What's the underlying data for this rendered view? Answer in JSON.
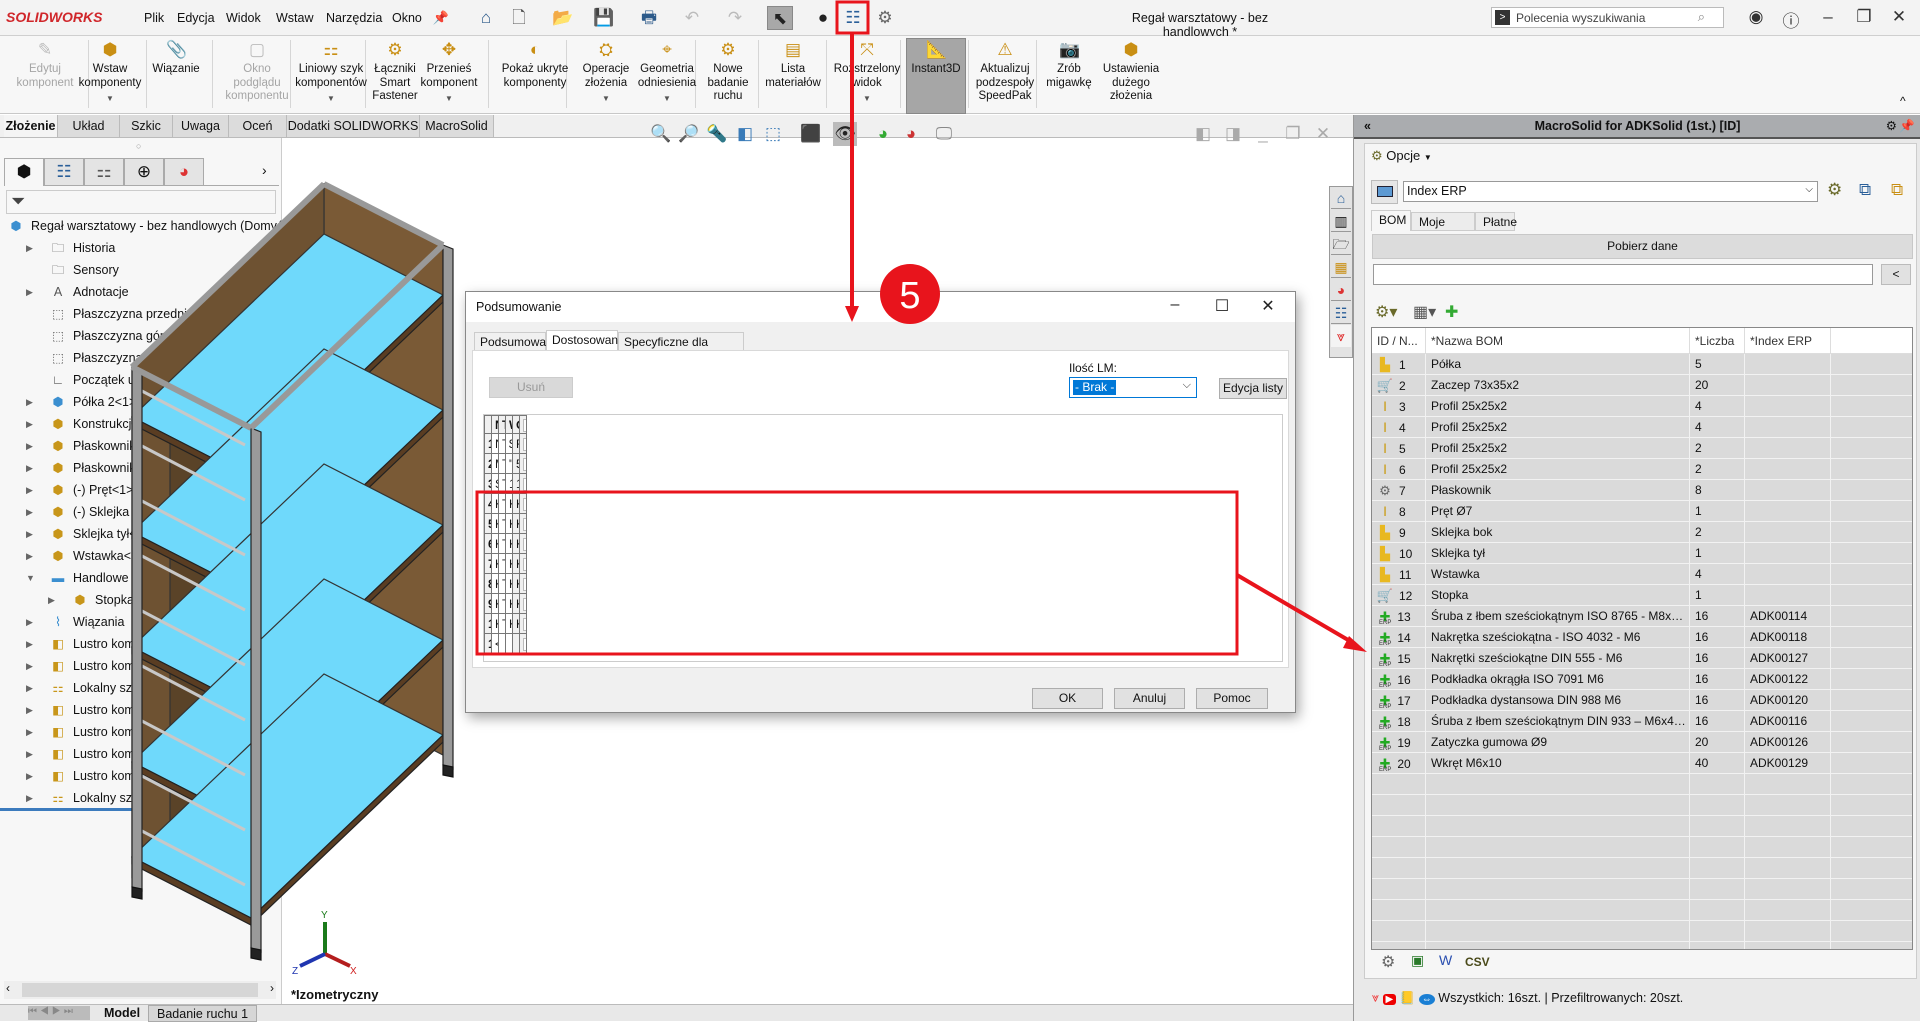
{
  "titlebar": {
    "app": "SOLIDWORKS",
    "menu": [
      "Plik",
      "Edycja",
      "Widok",
      "Wstaw",
      "Narzędzia",
      "Okno"
    ],
    "document_title": "Regał warsztatowy - bez handlowych *",
    "search_placeholder": "Polecenia wyszukiwania"
  },
  "ribbon": [
    {
      "label": "Edytuj\nkomponent",
      "icon": "edit-component-icon",
      "disabled": true
    },
    {
      "label": "Wstaw\nkomponenty",
      "icon": "insert-components-icon",
      "dropdown": true
    },
    {
      "label": "Wiązanie",
      "icon": "mate-paperclip-icon"
    },
    {
      "label": "Okno\npodglądu\nkomponentu",
      "icon": "component-preview-icon",
      "disabled": true
    },
    {
      "label": "Liniowy szyk\nkomponentów",
      "icon": "linear-pattern-icon",
      "dropdown": true
    },
    {
      "label": "Łączniki\nSmart\nFastener",
      "icon": "smart-fastener-icon"
    },
    {
      "label": "Przenieś\nkomponent",
      "icon": "move-component-icon",
      "dropdown": true
    },
    {
      "label": "Pokaż ukryte\nkomponenty",
      "icon": "show-hidden-icon"
    },
    {
      "label": "Operacje\nzłożenia",
      "icon": "assembly-features-icon",
      "dropdown": true
    },
    {
      "label": "Geometria\nodniesienia",
      "icon": "reference-geometry-icon",
      "dropdown": true
    },
    {
      "label": "Nowe\nbadanie\nruchu",
      "icon": "motion-study-icon"
    },
    {
      "label": "Lista\nmateriałów",
      "icon": "bill-of-materials-icon"
    },
    {
      "label": "Rozstrzelony\nwidok",
      "icon": "exploded-view-icon",
      "dropdown": true
    },
    {
      "label": "Instant3D",
      "icon": "instant3d-icon",
      "active": true
    },
    {
      "label": "Aktualizuj\npodzespoły\nSpeedPak",
      "icon": "speedpak-icon"
    },
    {
      "label": "Zrób\nmigawkę",
      "icon": "camera-icon"
    },
    {
      "label": "Ustawienia\ndużego\nzłożenia",
      "icon": "large-assembly-icon"
    }
  ],
  "cm_tabs": [
    "Złożenie",
    "Układ",
    "Szkic",
    "Uwaga",
    "Oceń",
    "Dodatki SOLIDWORKS",
    "MacroSolid"
  ],
  "tree": {
    "root": "Regał warsztatowy - bez handlowych  (Domyśln",
    "items": [
      {
        "label": "Historia",
        "icon": "history-folder-icon",
        "arrow": true,
        "indent": 0
      },
      {
        "label": "Sensory",
        "icon": "sensors-folder-icon",
        "arrow": false,
        "indent": 0
      },
      {
        "label": "Adnotacje",
        "icon": "annotations-folder-icon",
        "arrow": true,
        "indent": 0
      },
      {
        "label": "Płaszczyzna przednia",
        "icon": "plane-icon",
        "arrow": false,
        "indent": 0
      },
      {
        "label": "Płaszczyzna górna",
        "icon": "plane-icon",
        "arrow": false,
        "indent": 0
      },
      {
        "label": "Płaszczyzna prawa",
        "icon": "plane-icon",
        "arrow": false,
        "indent": 0
      },
      {
        "label": "Początek układu",
        "icon": "origin-icon",
        "arrow": false,
        "indent": 0
      },
      {
        "label": "Półka 2<1>",
        "icon": "subassembly-icon",
        "arrow": true,
        "indent": 0
      },
      {
        "label": "Konstrukcja<1>",
        "icon": "part-icon",
        "arrow": true,
        "indent": 0
      },
      {
        "label": "Płaskownik<1>",
        "icon": "part-icon",
        "arrow": true,
        "indent": 0
      },
      {
        "label": "Płaskownik<2>",
        "icon": "part-icon",
        "arrow": true,
        "indent": 0
      },
      {
        "label": "(-) Pręt<1>",
        "icon": "part-icon",
        "arrow": true,
        "indent": 0
      },
      {
        "label": "(-) Sklejka bok<1>",
        "icon": "part-icon",
        "arrow": true,
        "indent": 0
      },
      {
        "label": "Sklejka tył<1>",
        "icon": "part-icon",
        "arrow": true,
        "indent": 0
      },
      {
        "label": "Wstawka<1>",
        "icon": "part-icon",
        "arrow": true,
        "indent": 0
      },
      {
        "label": "Handlowe",
        "icon": "folder-icon",
        "arrow": true,
        "expanded": true,
        "indent": 0
      },
      {
        "label": "Stopka<1>",
        "icon": "part-icon",
        "arrow": true,
        "indent": 1
      },
      {
        "label": "Wiązania",
        "icon": "mates-icon",
        "arrow": true,
        "indent": 0
      },
      {
        "label": "Lustro komponentów",
        "icon": "mirror-components-icon",
        "arrow": true,
        "indent": 0
      },
      {
        "label": "Lustro komponentów",
        "icon": "mirror-components-icon",
        "arrow": true,
        "indent": 0
      },
      {
        "label": "Lokalny szyk liniowy",
        "icon": "local-pattern-icon",
        "arrow": true,
        "indent": 0
      },
      {
        "label": "Lustro komponentów",
        "icon": "mirror-components-icon",
        "arrow": true,
        "indent": 0
      },
      {
        "label": "Lustro komponentów",
        "icon": "mirror-components-icon",
        "arrow": true,
        "indent": 0
      },
      {
        "label": "Lustro komponentów",
        "icon": "mirror-components-icon",
        "arrow": true,
        "indent": 0
      },
      {
        "label": "Lustro komponentów",
        "icon": "mirror-components-icon",
        "arrow": true,
        "indent": 0
      },
      {
        "label": "Lokalny szyk liniowy",
        "icon": "local-pattern-icon",
        "arrow": true,
        "indent": 0
      }
    ]
  },
  "viewport": {
    "view_label": "*Izometryczny",
    "triad": {
      "x": "X",
      "y": "Y",
      "z": "Z"
    }
  },
  "bottom_tabs": [
    "Model",
    "Badanie ruchu 1"
  ],
  "dialog": {
    "title": "Podsumowanie",
    "tabs": [
      "Podsumowanie",
      "Dostosowany",
      "Specyficzne dla konfiguracji"
    ],
    "active_tab": "Dostosowany",
    "delete_label": "Usuń",
    "bom_qty_label": "Ilość LM:",
    "bom_qty_value": "- Brak -",
    "edit_list_label": "Edycja listy",
    "columns": [
      "Nazwa właściwości",
      "Typ",
      "Wartość / Wyrażenie tekstowe",
      "Oszacowana wartość"
    ],
    "rows": [
      {
        "n": "1",
        "name": "Nazwa",
        "type": "Tekst",
        "value": "$PRP:\"SW-Nazwa pliku\"",
        "evaluated": "Regał warsztatowy - bez ha"
      },
      {
        "n": "2",
        "name": "Masa",
        "type": "Tekst",
        "value": "\"SW-Masa@Regał warsztatowy - bez handlowych.SL",
        "evaluated": "56227.33"
      },
      {
        "n": "3",
        "name": "Szt.",
        "type": "Tekst",
        "value": "1",
        "evaluated": "1"
      },
      {
        "n": "4",
        "name": "KOMPONENT-0",
        "type": "Tekst",
        "value": "KOMPONENT;ADK00114;Śruba z łbem sześciokątnym",
        "evaluated": "KOMPONENT;ADK00114;Śr"
      },
      {
        "n": "5",
        "name": "KOMPONENT-1",
        "type": "Tekst",
        "value": "KOMPONENT;ADK00118;Nakrętka sześciokątna - ISO",
        "evaluated": "KOMPONENT;ADK00118;Na"
      },
      {
        "n": "6",
        "name": "KOMPONENT-2",
        "type": "Tekst",
        "value": "KOMPONENT;ADK00127;Nakrętki sześciokątne DIN 5",
        "evaluated": "KOMPONENT;ADK00127;Na"
      },
      {
        "n": "7",
        "name": "KOMPONENT-3",
        "type": "Tekst",
        "value": "KOMPONENT;ADK00122;Podkładka okrągła ISO 7091",
        "evaluated": "KOMPONENT;ADK00122;Po"
      },
      {
        "n": "8",
        "name": "KOMPONENT-4",
        "type": "Tekst",
        "value": "KOMPONENT;ADK00120;Podkładka dystansowa DIN",
        "evaluated": "KOMPONENT;ADK00120;Po"
      },
      {
        "n": "9",
        "name": "KOMPONENT-5",
        "type": "Tekst",
        "value": "KOMPONENT;ADK00116;Śruba z łbem sześciokątnym",
        "evaluated": "KOMPONENT;ADK00116;Śr"
      },
      {
        "n": "10",
        "name": "KOMPONENT-6",
        "type": "Tekst",
        "value": "KOMPONENT;ADK00126;Zatyczka gumowa Ø9;20;szt;;",
        "evaluated": "KOMPONENT;ADK00126;Zat"
      },
      {
        "n": "11",
        "name": "<Wpisz nową właściwo",
        "type": "",
        "value": "",
        "evaluated": ""
      }
    ],
    "ok_label": "OK",
    "cancel_label": "Anuluj",
    "help_label": "Pomoc"
  },
  "macrosolid": {
    "title": "MacroSolid for ADKSolid (1st.) [ID]",
    "options_label": "Opcje",
    "property_combo": "Index ERP",
    "tabs": [
      "BOM",
      "Moje makra",
      "Płatne"
    ],
    "fetch_label": "Pobierz dane",
    "filter_value": "",
    "filter_button": "<",
    "columns": [
      "ID / N...",
      "*Nazwa BOM",
      "*Liczba",
      "*Index ERP"
    ],
    "rows": [
      {
        "id": "1",
        "icon": "part",
        "name": "Półka",
        "qty": "5",
        "erp": ""
      },
      {
        "id": "2",
        "icon": "cart",
        "name": "Zaczep 73x35x2",
        "qty": "20",
        "erp": ""
      },
      {
        "id": "3",
        "icon": "beam",
        "name": "Profil 25x25x2",
        "qty": "4",
        "erp": ""
      },
      {
        "id": "4",
        "icon": "beam",
        "name": "Profil 25x25x2",
        "qty": "4",
        "erp": ""
      },
      {
        "id": "5",
        "icon": "beam",
        "name": "Profil 25x25x2",
        "qty": "2",
        "erp": ""
      },
      {
        "id": "6",
        "icon": "beam",
        "name": "Profil 25x25x2",
        "qty": "2",
        "erp": ""
      },
      {
        "id": "7",
        "icon": "sheet",
        "name": "Płaskownik",
        "qty": "8",
        "erp": ""
      },
      {
        "id": "8",
        "icon": "beam",
        "name": "Pręt Ø7",
        "qty": "1",
        "erp": ""
      },
      {
        "id": "9",
        "icon": "part",
        "name": "Sklejka bok",
        "qty": "2",
        "erp": ""
      },
      {
        "id": "10",
        "icon": "part",
        "name": "Sklejka tył",
        "qty": "1",
        "erp": ""
      },
      {
        "id": "11",
        "icon": "part",
        "name": "Wstawka",
        "qty": "4",
        "erp": ""
      },
      {
        "id": "12",
        "icon": "cart",
        "name": "Stopka",
        "qty": "1",
        "erp": ""
      },
      {
        "id": "13",
        "icon": "erp",
        "name": "Śruba z łbem sześciokątnym ISO 8765 - M8x40 ...",
        "qty": "16",
        "erp": "ADK00114"
      },
      {
        "id": "14",
        "icon": "erp",
        "name": "Nakrętka sześciokątna - ISO 4032 - M6",
        "qty": "16",
        "erp": "ADK00118"
      },
      {
        "id": "15",
        "icon": "erp",
        "name": "Nakrętki sześciokątne DIN 555 - M6",
        "qty": "16",
        "erp": "ADK00127"
      },
      {
        "id": "16",
        "icon": "erp",
        "name": "Podkładka okrągła ISO 7091 M6",
        "qty": "16",
        "erp": "ADK00122"
      },
      {
        "id": "17",
        "icon": "erp",
        "name": "Podkładka dystansowa DIN 988 M6",
        "qty": "16",
        "erp": "ADK00120"
      },
      {
        "id": "18",
        "icon": "erp",
        "name": "Śruba z łbem sześciokątnym DIN 933 – M6x40 –...",
        "qty": "16",
        "erp": "ADK00116"
      },
      {
        "id": "19",
        "icon": "erp",
        "name": "Zatyczka gumowa Ø9",
        "qty": "20",
        "erp": "ADK00126"
      },
      {
        "id": "20",
        "icon": "erp",
        "name": "Wkręt M6x10",
        "qty": "40",
        "erp": "ADK00129"
      }
    ],
    "erp_icon_label": "ERP",
    "csv_label": "CSV",
    "status": "Wszystkich: 16szt. | Przefiltrowanych: 20szt."
  },
  "annotation": {
    "step": "5",
    "color": "#e8141c"
  },
  "colors": {
    "accent": "#0078d7",
    "highlight_red": "#e8141c",
    "shelf_blue": "#6fd9fb",
    "plywood": "#6e5232"
  }
}
